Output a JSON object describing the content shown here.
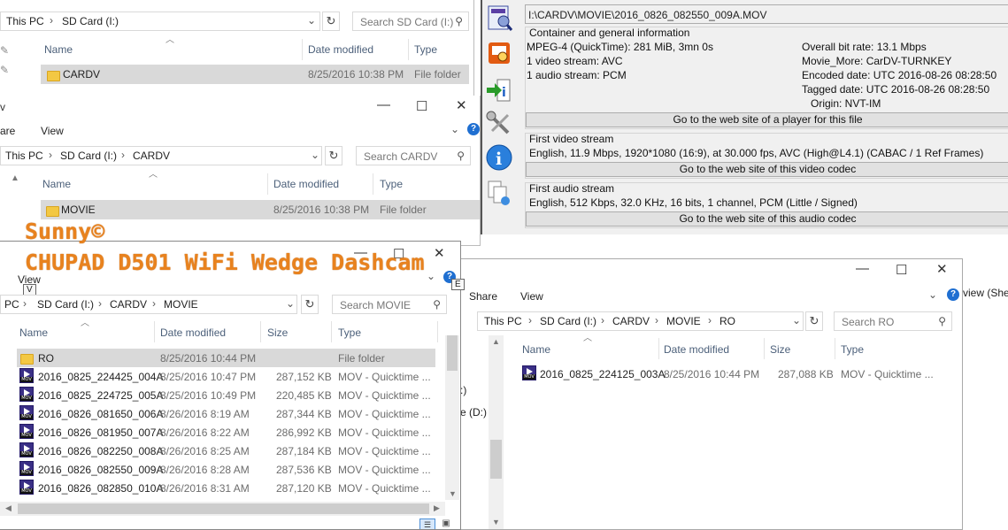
{
  "win1": {
    "breadcrumb": [
      "This PC",
      "SD Card (I:)"
    ],
    "search_placeholder": "Search SD Card (I:)",
    "columns": {
      "name": "Name",
      "date": "Date modified",
      "type": "Type"
    },
    "row": {
      "name": "CARDV",
      "date": "8/25/2016 10:38 PM",
      "type": "File folder"
    }
  },
  "win2": {
    "ribbon": {
      "share": "are",
      "view": "View"
    },
    "breadcrumb": [
      "This PC",
      "SD Card (I:)",
      "CARDV"
    ],
    "search_placeholder": "Search CARDV",
    "columns": {
      "name": "Name",
      "date": "Date modified",
      "type": "Type"
    },
    "row": {
      "name": "MOVIE",
      "date": "8/25/2016 10:38 PM",
      "type": "File folder"
    }
  },
  "win3": {
    "ribbon": {
      "view": "View",
      "view_key": "V"
    },
    "breadcrumb": [
      "PC",
      "SD Card (I:)",
      "CARDV",
      "MOVIE"
    ],
    "search_placeholder": "Search MOVIE",
    "columns": {
      "name": "Name",
      "date": "Date modified",
      "size": "Size",
      "type": "Type"
    },
    "rows": [
      {
        "kind": "folder",
        "name": "RO",
        "date": "8/25/2016 10:44 PM",
        "size": "",
        "type": "File folder"
      },
      {
        "kind": "mov",
        "name": "2016_0825_224425_004A",
        "date": "8/25/2016 10:47 PM",
        "size": "287,152 KB",
        "type": "MOV - Quicktime ..."
      },
      {
        "kind": "mov",
        "name": "2016_0825_224725_005A",
        "date": "8/25/2016 10:49 PM",
        "size": "220,485 KB",
        "type": "MOV - Quicktime ..."
      },
      {
        "kind": "mov",
        "name": "2016_0826_081650_006A",
        "date": "8/26/2016 8:19 AM",
        "size": "287,344 KB",
        "type": "MOV - Quicktime ..."
      },
      {
        "kind": "mov",
        "name": "2016_0826_081950_007A",
        "date": "8/26/2016 8:22 AM",
        "size": "286,992 KB",
        "type": "MOV - Quicktime ..."
      },
      {
        "kind": "mov",
        "name": "2016_0826_082250_008A",
        "date": "8/26/2016 8:25 AM",
        "size": "287,184 KB",
        "type": "MOV - Quicktime ..."
      },
      {
        "kind": "mov",
        "name": "2016_0826_082550_009A",
        "date": "8/26/2016 8:28 AM",
        "size": "287,536 KB",
        "type": "MOV - Quicktime ..."
      },
      {
        "kind": "mov",
        "name": "2016_0826_082850_010A",
        "date": "8/26/2016 8:31 AM",
        "size": "287,120 KB",
        "type": "MOV - Quicktime ..."
      }
    ]
  },
  "win4": {
    "ribbon": {
      "share": "Share",
      "view": "View",
      "view_she": "view (She",
      "key_e": "E"
    },
    "breadcrumb": [
      "This PC",
      "SD Card (I:)",
      "CARDV",
      "MOVIE",
      "RO"
    ],
    "search_placeholder": "Search RO",
    "nav": {
      "item1": ":)",
      "item2": "e (D:)"
    },
    "columns": {
      "name": "Name",
      "date": "Date modified",
      "size": "Size",
      "type": "Type"
    },
    "row": {
      "name": "2016_0825_224125_003A",
      "date": "8/25/2016 10:44 PM",
      "size": "287,088 KB",
      "type": "MOV - Quicktime ..."
    }
  },
  "mediainfo": {
    "filepath": "I:\\CARDV\\MOVIE\\2016_0826_082550_009A.MOV",
    "general": {
      "header": "Container and general information",
      "left": [
        "MPEG-4 (QuickTime): 281 MiB, 3mn 0s",
        "1 video stream: AVC",
        "1 audio stream: PCM"
      ],
      "right": [
        "Overall bit rate: 13.1 Mbps",
        "Movie_More: CarDV-TURNKEY",
        "Encoded date: UTC 2016-08-26 08:28:50",
        "Tagged date: UTC 2016-08-26 08:28:50",
        "Origin: NVT-IM"
      ],
      "button": "Go to the web site of a player for this file"
    },
    "video": {
      "header": "First video stream",
      "line": "English, 11.9 Mbps, 1920*1080 (16:9), at 30.000 fps, AVC (High@L4.1) (CABAC / 1 Ref Frames)",
      "button": "Go to the web site of this video codec"
    },
    "audio": {
      "header": "First audio stream",
      "line": "English, 512 Kbps, 32.0 KHz, 16 bits, 1 channel, PCM (Little / Signed)",
      "button": "Go to the web site of this audio codec"
    }
  },
  "overlay": {
    "line1": "Sunny©",
    "line2": "CHUPAD D501 WiFi Wedge Dashcam"
  }
}
